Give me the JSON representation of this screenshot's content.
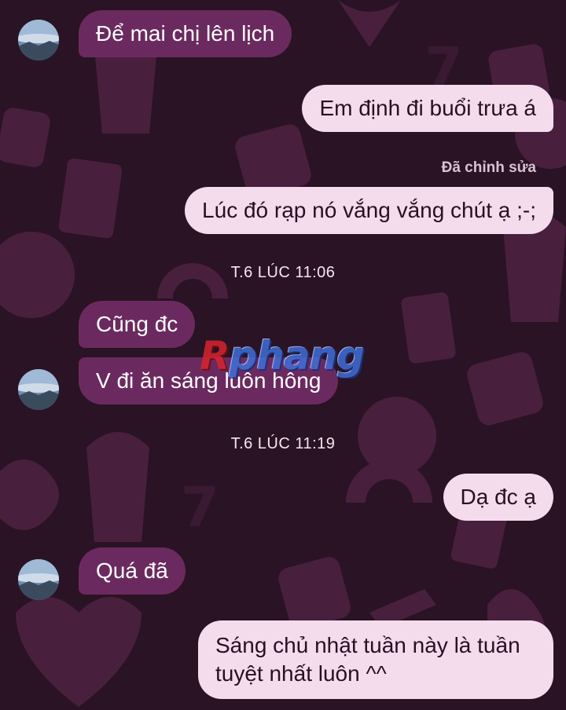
{
  "messages": [
    {
      "side": "in",
      "text": "Để mai chị lên lịch"
    },
    {
      "side": "out",
      "text": "Em định đi buổi trưa á"
    },
    {
      "side": "out",
      "text": "Lúc đó rạp nó vắng vắng chút ạ ;-;",
      "edited_label": "Đã chỉnh sửa"
    },
    {
      "side": "in",
      "text": "Cũng đc"
    },
    {
      "side": "in",
      "text": "V đi ăn sáng luôn hông"
    },
    {
      "side": "out",
      "text": "Dạ đc ạ"
    },
    {
      "side": "in",
      "text": "Quá đã"
    },
    {
      "side": "out",
      "text_line1": "Sáng chủ nhật tuần này là tuần",
      "text_line2": "tuyệt nhất luôn ^^"
    }
  ],
  "timestamps": [
    "T.6 LÚC 11:06",
    "T.6 LÚC 11:19"
  ],
  "watermark": {
    "first": "R",
    "rest": "phang"
  },
  "icons": [
    "contact-avatar"
  ],
  "colors": {
    "background": "#2a1324",
    "incoming_bubble": "#6b2a5f",
    "outgoing_bubble": "#f4dcec"
  }
}
